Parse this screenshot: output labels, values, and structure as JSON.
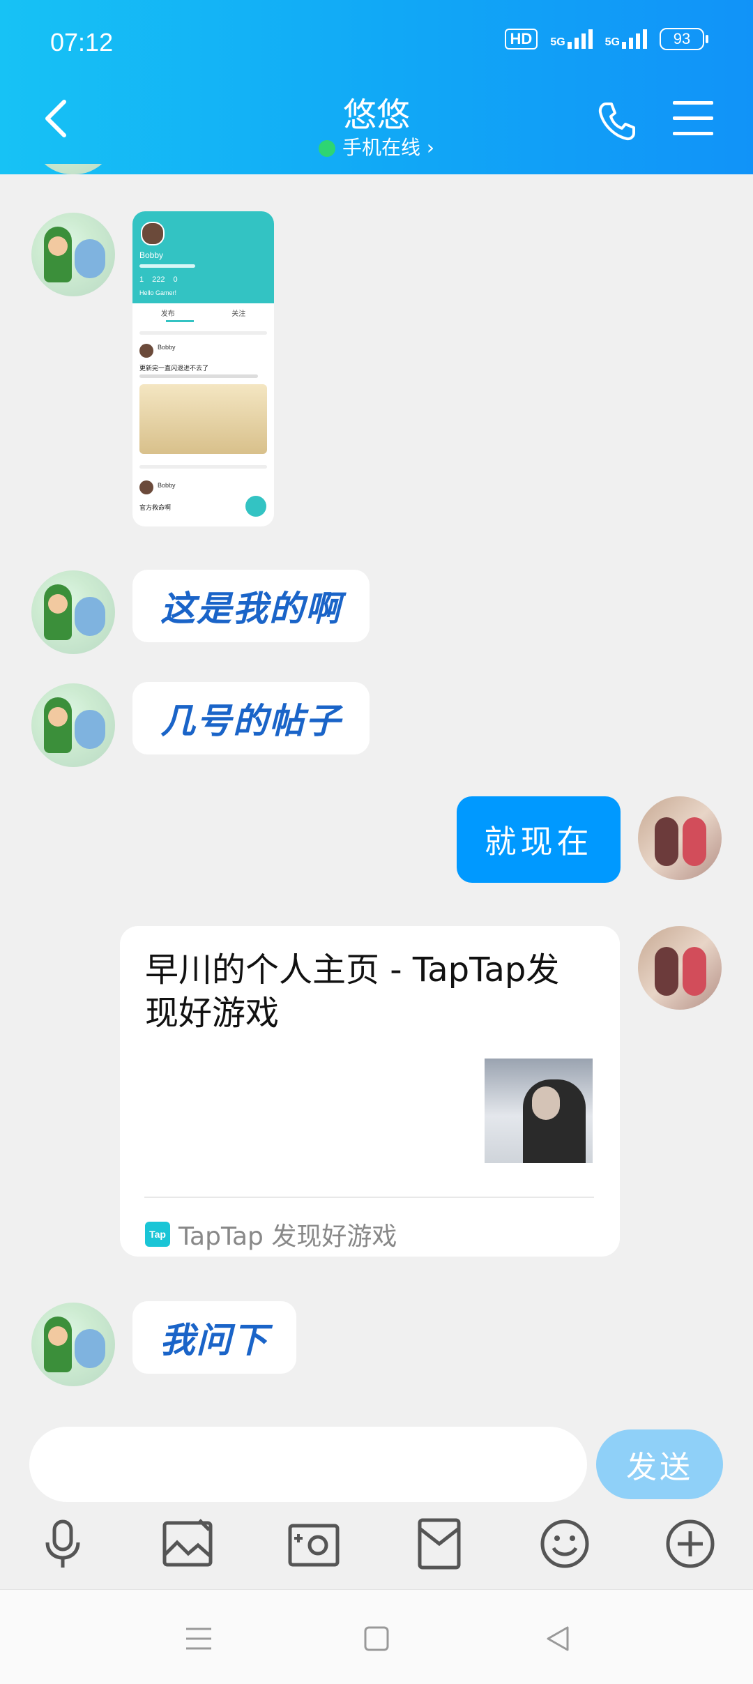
{
  "status_bar": {
    "time": "07:12",
    "hd_label": "HD",
    "signal1_label": "5G",
    "signal2_label": "5G",
    "battery": "93"
  },
  "header": {
    "title": "悠悠",
    "subtitle": "手机在线 ›"
  },
  "image_card": {
    "profile_name": "Bobby",
    "post_title": "更新完一直闪退进不去了",
    "post_tabs": [
      "发布",
      "关注"
    ],
    "post2_title": "官方救命啊",
    "stat1": "1",
    "stat2": "222",
    "stat3": "0",
    "greeting": "Hello Gamer!"
  },
  "messages": [
    {
      "side": "left",
      "text": "这是我的啊"
    },
    {
      "side": "left",
      "text": "几号的帖子"
    },
    {
      "side": "right",
      "text": "就现在"
    },
    {
      "side": "right",
      "type": "link",
      "title": "早川的个人主页 - TapTap发现好游戏",
      "source_logo": "Tap",
      "source_name": "TapTap 发现好游戏"
    },
    {
      "side": "left",
      "text": "我问下"
    }
  ],
  "input": {
    "placeholder": "",
    "send_label": "发送"
  },
  "toolbar": [
    "microphone-icon",
    "image-icon",
    "camera-icon",
    "red-packet-icon",
    "emoji-icon",
    "plus-icon"
  ],
  "nav": [
    "menu-icon",
    "home-icon",
    "back-icon"
  ],
  "colors": {
    "accent": "#0099ff",
    "header_gradient_start": "#17c2f5",
    "header_gradient_end": "#1193f8",
    "left_bubble_text": "#1a64c8",
    "send_button": "#8fd0f8"
  }
}
